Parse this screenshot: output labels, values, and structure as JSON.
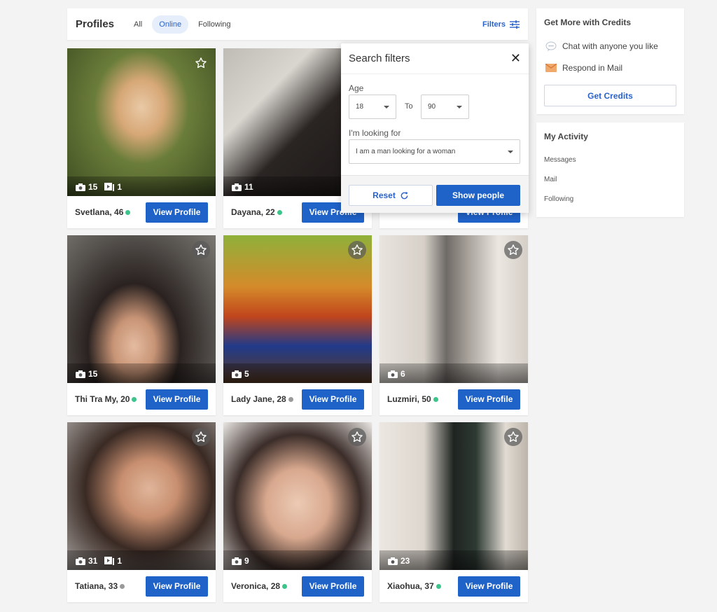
{
  "header": {
    "title": "Profiles",
    "tabs": [
      {
        "label": "All"
      },
      {
        "label": "Online",
        "active": true
      },
      {
        "label": "Following"
      }
    ],
    "filters_label": "Filters"
  },
  "profiles": [
    {
      "name": "Svetlana, 46",
      "online": true,
      "photos": "15",
      "videos": "1",
      "view_label": "View Profile"
    },
    {
      "name": "Dayana, 22",
      "online": true,
      "photos": "11",
      "view_label": "View Profile"
    },
    {
      "name": "",
      "online": false,
      "photos": "",
      "view_label": "View Profile"
    },
    {
      "name": "Thi Tra My, 20",
      "online": true,
      "photos": "15",
      "view_label": "View Profile"
    },
    {
      "name": "Lady Jane, 28",
      "online": false,
      "photos": "5",
      "view_label": "View Profile"
    },
    {
      "name": "Luzmiri, 50",
      "online": true,
      "photos": "6",
      "view_label": "View Profile"
    },
    {
      "name": "Tatiana, 33",
      "online": false,
      "photos": "31",
      "videos": "1",
      "view_label": "View Profile"
    },
    {
      "name": "Veronica, 28",
      "online": true,
      "photos": "9",
      "view_label": "View Profile"
    },
    {
      "name": "Xiaohua, 37",
      "online": true,
      "photos": "23",
      "view_label": "View Profile"
    }
  ],
  "search_filters": {
    "title": "Search filters",
    "age_label": "Age",
    "age_from": "18",
    "to_label": "To",
    "age_to": "90",
    "looking_label": "I'm looking for",
    "looking_value": "I am a man looking for a woman",
    "reset_label": "Reset",
    "show_label": "Show people"
  },
  "credits": {
    "title": "Get More with Credits",
    "items": [
      {
        "label": "Chat with anyone you like",
        "icon": "chat-bubble-icon"
      },
      {
        "label": "Respond in Mail",
        "icon": "mail-envelope-icon"
      }
    ],
    "button_label": "Get Credits"
  },
  "activity": {
    "title": "My Activity",
    "links": [
      "Messages",
      "Mail",
      "Following"
    ]
  },
  "colors": {
    "accent": "#1f62c8",
    "online": "#3cc48a",
    "offline": "#9a9a9a"
  }
}
